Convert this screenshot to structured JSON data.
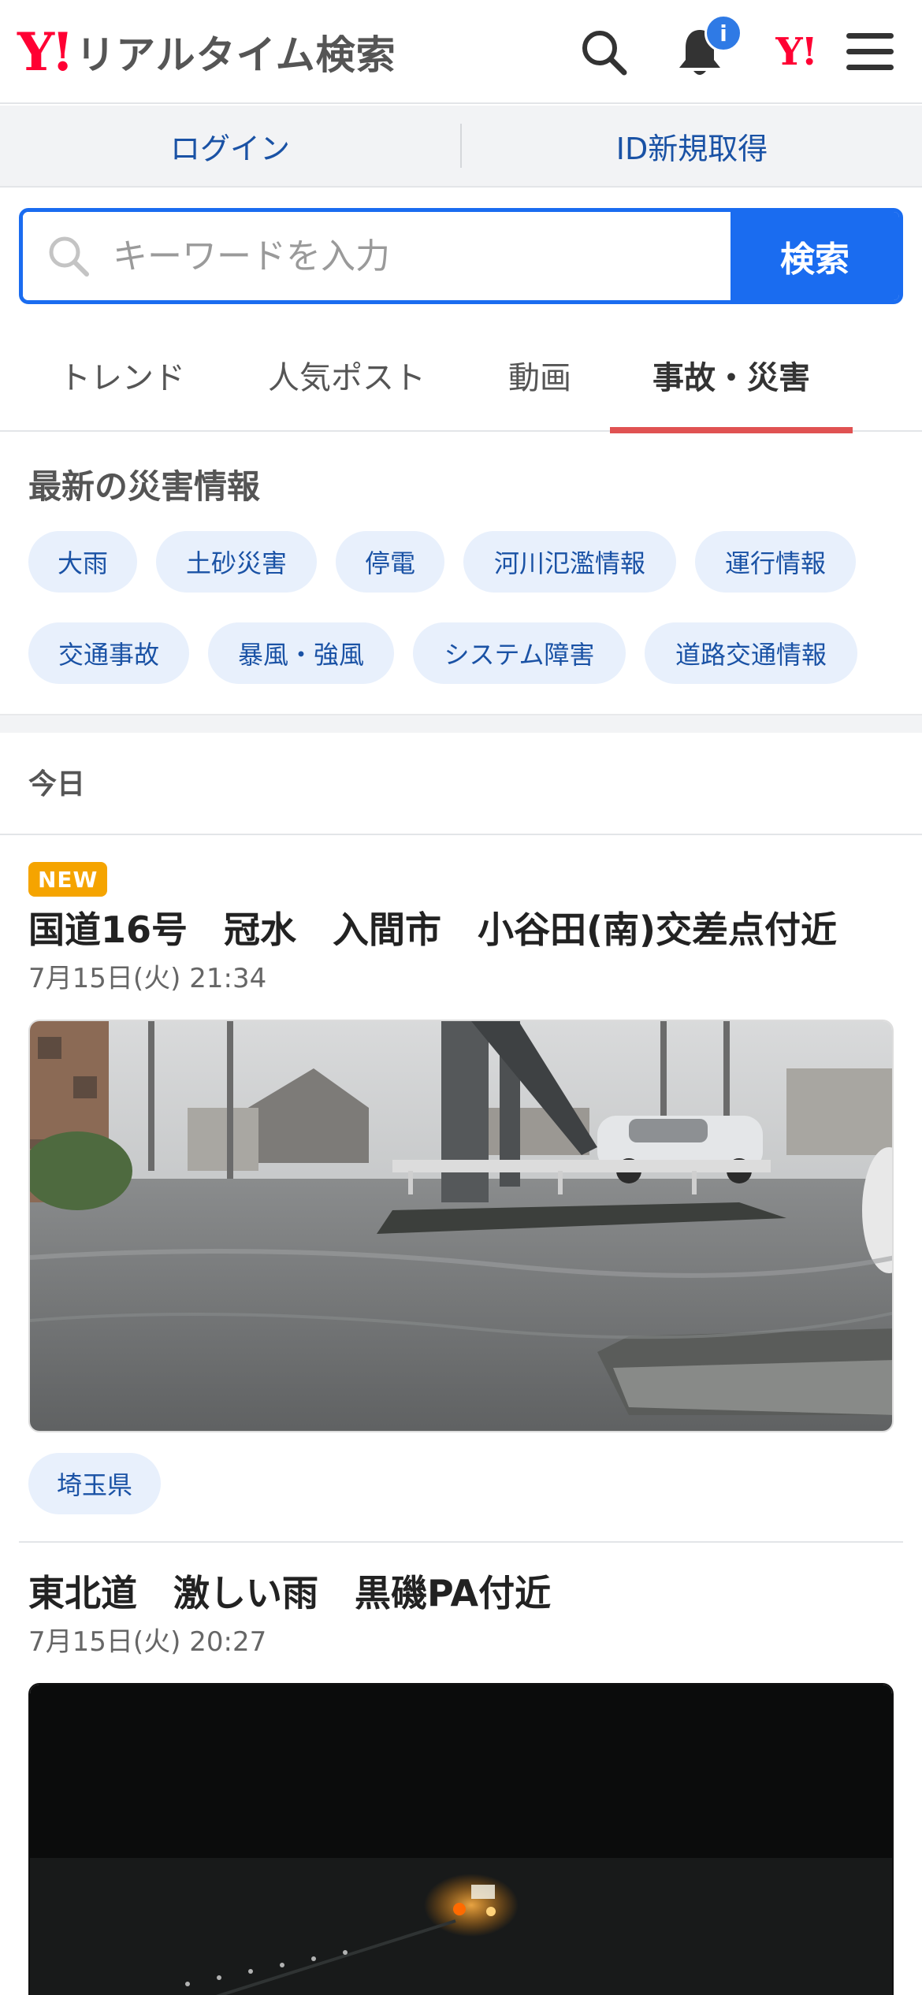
{
  "header": {
    "logo_mark": "Y!",
    "logo_text": "リアルタイム検索",
    "notification_badge": "i",
    "yahoo_mark": "Y!"
  },
  "account": {
    "login": "ログイン",
    "signup": "ID新規取得"
  },
  "search": {
    "placeholder": "キーワードを入力",
    "button": "検索"
  },
  "tabs": [
    {
      "label": "トレンド"
    },
    {
      "label": "人気ポスト"
    },
    {
      "label": "動画"
    },
    {
      "label": "事故・災害",
      "active": true
    }
  ],
  "disaster": {
    "title": "最新の災害情報",
    "chips": [
      "大雨",
      "土砂災害",
      "停電",
      "河川氾濫情報",
      "運行情報",
      "交通事故",
      "暴風・強風",
      "システム障害",
      "道路交通情報"
    ]
  },
  "feed": {
    "date_label": "今日",
    "posts": [
      {
        "badge": "NEW",
        "title": "国道16号　冠水　入間市　小谷田(南)交差点付近",
        "time": "7月15日(火) 21:34",
        "tag": "埼玉県"
      },
      {
        "title": "東北道　激しい雨　黒磯PA付近",
        "time": "7月15日(火) 20:27"
      }
    ]
  },
  "colors": {
    "brand_red": "#ff0033",
    "accent_blue": "#1a6cf0",
    "link_blue": "#1a52a5",
    "tab_underline": "#e05252",
    "new_badge": "#f5a400"
  }
}
